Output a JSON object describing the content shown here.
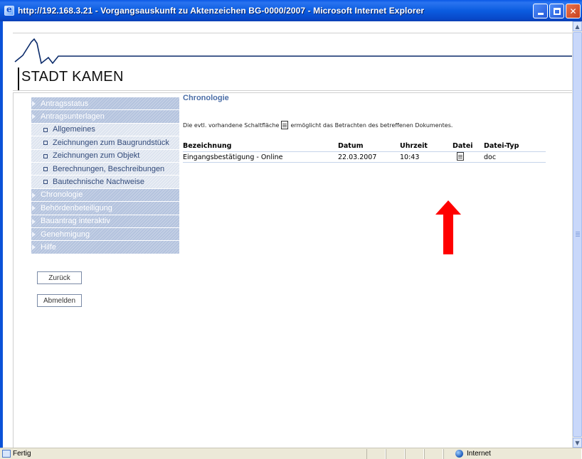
{
  "window": {
    "title": "http://192.168.3.21 - Vorgangsauskunft zu Aktenzeichen BG-0000/2007 - Microsoft Internet Explorer"
  },
  "header": {
    "logo_text": "STADT KAMEN"
  },
  "nav": {
    "items": [
      {
        "label": "Antragsstatus",
        "type": "parent"
      },
      {
        "label": "Antragsunterlagen",
        "type": "parent"
      },
      {
        "label": "Allgemeines",
        "type": "sub"
      },
      {
        "label": "Zeichnungen zum Baugrundstück",
        "type": "sub"
      },
      {
        "label": "Zeichnungen zum Objekt",
        "type": "sub"
      },
      {
        "label": "Berechnungen, Beschreibungen",
        "type": "sub"
      },
      {
        "label": "Bautechnische Nachweise",
        "type": "sub"
      },
      {
        "label": "Chronologie",
        "type": "parent"
      },
      {
        "label": "Behördenbeteiligung",
        "type": "parent"
      },
      {
        "label": "Bauantrag interaktiv",
        "type": "parent"
      },
      {
        "label": "Genehmigung",
        "type": "parent"
      },
      {
        "label": "Hilfe",
        "type": "parent"
      }
    ],
    "back_button": "Zurück",
    "logout_button": "Abmelden"
  },
  "main": {
    "title": "Chronologie",
    "hint_before": "Die evtl. vorhandene Schaltfläche",
    "hint_after": "ermöglicht das Betrachten des betreffenen Dokumentes.",
    "table": {
      "headers": [
        "Bezeichnung",
        "Datum",
        "Uhrzeit",
        "Datei",
        "Datei-Typ"
      ],
      "rows": [
        [
          "Eingangsbestätigung - Online",
          "22.03.2007",
          "10:43",
          "document-icon",
          "doc"
        ]
      ]
    }
  },
  "statusbar": {
    "status": "Fertig",
    "zone": "Internet"
  },
  "colors": {
    "nav_active": "#b4c3de",
    "nav_sub": "#dde4ef",
    "title_blue": "#4b6ea7",
    "arrow_red": "#ff0000"
  }
}
